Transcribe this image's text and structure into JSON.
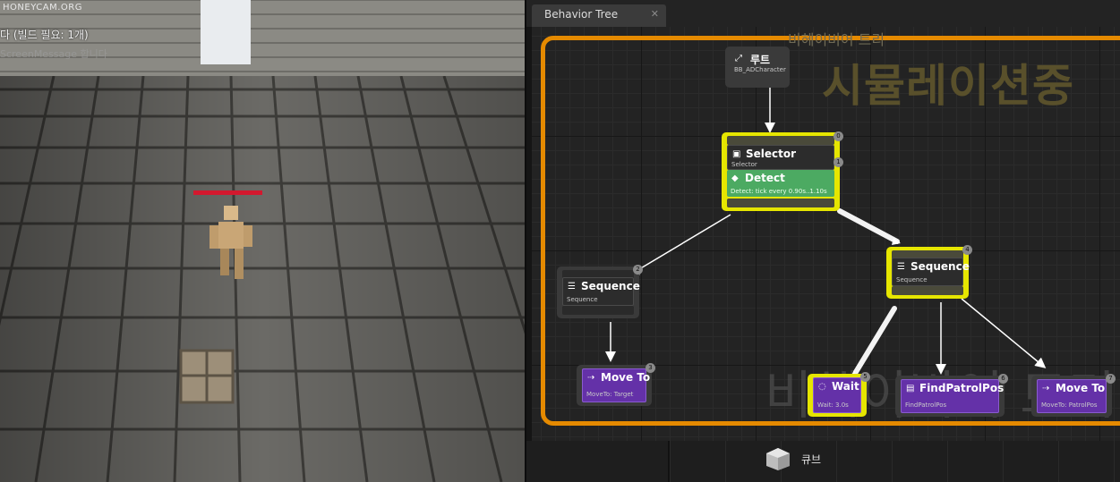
{
  "viewport": {
    "watermark": "HONEYCAM.ORG",
    "message": "다 (빌드 필요: 1개)",
    "message2": "ScreenMessage 합니다",
    "health_fraction": 1.0,
    "colors": {
      "health": "#d3182e",
      "floor": "#6e6d69"
    }
  },
  "panel": {
    "tab_title": "Behavior Tree",
    "tab_close": "✕",
    "frame_title": "비헤이비어 트리",
    "overlay_text": "시뮬레이션중",
    "bottom_watermark": "비헤이비어 트리",
    "colors": {
      "frame": "#e58a00",
      "active": "#e6e600",
      "task": "#6431a8",
      "decorator": "#4caa62"
    }
  },
  "nodes": {
    "root": {
      "title": "루트",
      "sub": "BB_ADCharacter",
      "icon": "root-icon"
    },
    "selector": {
      "title": "Selector",
      "sub": "Selector",
      "badge": "0",
      "badge2": "1",
      "icon": "selector-icon"
    },
    "detect": {
      "title": "Detect",
      "sub": "Detect: tick every 0.90s..1.10s",
      "icon": "service-icon"
    },
    "seq_left": {
      "title": "Sequence",
      "sub": "Sequence",
      "badge": "2",
      "icon": "sequence-icon"
    },
    "move_left": {
      "title": "Move To",
      "sub": "MoveTo: Target",
      "badge": "3",
      "icon": "moveto-icon"
    },
    "seq_right": {
      "title": "Sequence",
      "sub": "Sequence",
      "badge": "4",
      "icon": "sequence-icon"
    },
    "wait": {
      "title": "Wait",
      "sub": "Wait: 3.0s",
      "badge": "5",
      "icon": "wait-icon"
    },
    "find": {
      "title": "FindPatrolPos",
      "sub": "FindPatrolPos",
      "badge": "6",
      "icon": "task-icon"
    },
    "move_right": {
      "title": "Move To",
      "sub": "MoveTo: PatrolPos",
      "badge": "7",
      "icon": "moveto-icon"
    }
  },
  "content_browser": {
    "item_label": "큐브",
    "item_icon": "cube-icon"
  }
}
